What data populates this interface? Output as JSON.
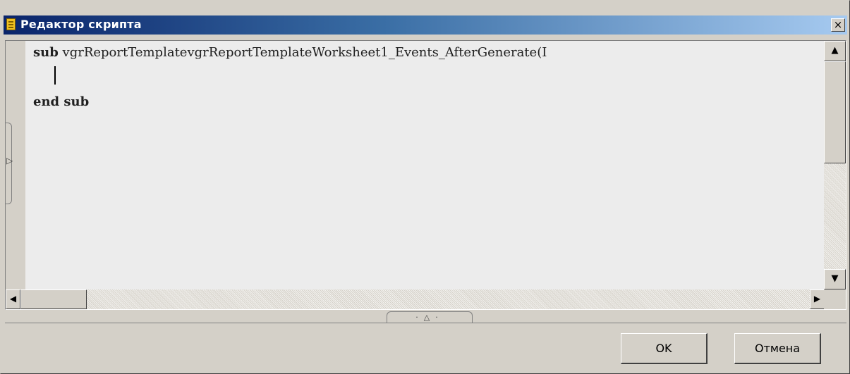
{
  "window": {
    "title": "Редактор скрипта",
    "close_label": "×"
  },
  "editor": {
    "line1_keyword": "sub",
    "line1_rest": " vgrReportTemplatevgrReportTemplateWorksheet1_Events_AfterGenerate(I",
    "line3_text": "end sub"
  },
  "gutter": {
    "fold_arrow": "▷"
  },
  "scrollbars": {
    "up_arrow": "▲",
    "down_arrow": "▼",
    "left_arrow": "◀",
    "right_arrow": "▶"
  },
  "splitter": {
    "label": "·△·"
  },
  "buttons": {
    "ok_label": "OK",
    "cancel_label": "Отмена"
  },
  "colors": {
    "title_gradient_start": "#0a246a",
    "title_gradient_end": "#a6caf0",
    "face": "#d4d0c8",
    "editor_bg": "#ececec"
  }
}
